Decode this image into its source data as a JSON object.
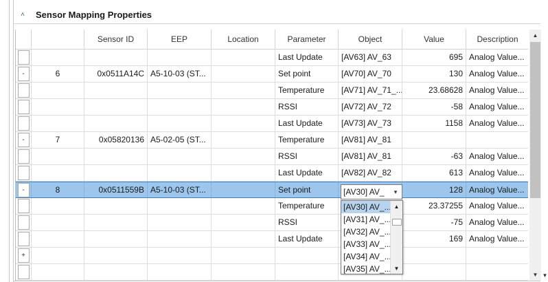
{
  "section": {
    "title": "Sensor Mapping Properties",
    "collapse_glyph": "˄"
  },
  "columns": [
    "",
    "",
    "Sensor ID",
    "EEP",
    "Location",
    "Parameter",
    "Object",
    "Value",
    "Description"
  ],
  "rows": [
    {
      "btn": "",
      "num": "",
      "sid": "",
      "eep": "",
      "loc": "",
      "par": "Last Update",
      "obj": "[AV63] AV_63",
      "val": "695",
      "desc": "Analog Value..."
    },
    {
      "btn": "-",
      "num": "6",
      "sid": "0x0511A14C",
      "eep": "A5-10-03 (ST...",
      "loc": "",
      "par": "Set point",
      "obj": "[AV70] AV_70",
      "val": "130",
      "desc": "Analog Value..."
    },
    {
      "btn": "",
      "num": "",
      "sid": "",
      "eep": "",
      "loc": "",
      "par": "Temperature",
      "obj": "[AV71] AV_71_...",
      "val": "23.68628",
      "desc": "Analog Value..."
    },
    {
      "btn": "",
      "num": "",
      "sid": "",
      "eep": "",
      "loc": "",
      "par": "RSSI",
      "obj": "[AV72] AV_72",
      "val": "-58",
      "desc": "Analog Value..."
    },
    {
      "btn": "",
      "num": "",
      "sid": "",
      "eep": "",
      "loc": "",
      "par": "Last Update",
      "obj": "[AV73] AV_73",
      "val": "1158",
      "desc": "Analog Value..."
    },
    {
      "btn": "-",
      "num": "7",
      "sid": "0x05820136",
      "eep": "A5-02-05 (ST...",
      "loc": "",
      "par": "Temperature",
      "obj": "[AV81] AV_81",
      "val": "",
      "desc": ""
    },
    {
      "btn": "",
      "num": "",
      "sid": "",
      "eep": "",
      "loc": "",
      "par": "RSSI",
      "obj": "[AV81] AV_81",
      "val": "-63",
      "desc": "Analog Value..."
    },
    {
      "btn": "",
      "num": "",
      "sid": "",
      "eep": "",
      "loc": "",
      "par": "Last Update",
      "obj": "[AV82] AV_82",
      "val": "613",
      "desc": "Analog Value..."
    },
    {
      "btn": "-",
      "num": "8",
      "sid": "0x0511559B",
      "eep": "A5-10-03 (ST...",
      "loc": "",
      "par": "Set point",
      "obj": "",
      "val": "128",
      "desc": "Analog Value..."
    },
    {
      "btn": "",
      "num": "",
      "sid": "",
      "eep": "",
      "loc": "",
      "par": "Temperature",
      "obj": "",
      "val": "23.37255",
      "desc": "Analog Value..."
    },
    {
      "btn": "",
      "num": "",
      "sid": "",
      "eep": "",
      "loc": "",
      "par": "RSSI",
      "obj": "",
      "val": "-75",
      "desc": "Analog Value..."
    },
    {
      "btn": "",
      "num": "",
      "sid": "",
      "eep": "",
      "loc": "",
      "par": "Last Update",
      "obj": "",
      "val": "169",
      "desc": "Analog Value..."
    },
    {
      "btn": "+",
      "num": "",
      "sid": "",
      "eep": "",
      "loc": "",
      "par": "",
      "obj": "",
      "val": "",
      "desc": ""
    },
    {
      "btn": "",
      "num": "",
      "sid": "",
      "eep": "",
      "loc": "",
      "par": "",
      "obj": "",
      "val": "",
      "desc": ""
    }
  ],
  "selected_row_index": 8,
  "object_combo": {
    "value": "[AV30] AV_",
    "arrow": "▾"
  },
  "dropdown_items": [
    "[AV30] AV_...",
    "[AV31] AV_...",
    "[AV32] AV_...",
    "[AV33] AV_...",
    "[AV34] AV_...",
    "[AV35] AV_..."
  ],
  "dropdown_highlight_index": 0,
  "colors": {
    "selection": "#9cc6ec",
    "accent": "#2563a8",
    "highlight": "#b8d3ee"
  }
}
